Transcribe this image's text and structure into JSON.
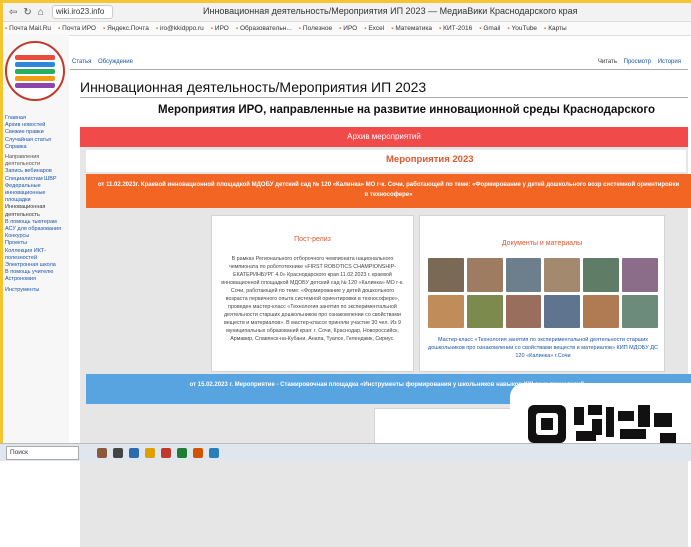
{
  "browser": {
    "url": "wiki.iro23.info",
    "title": "Инновационная деятельность/Мероприятия ИП 2023 — МедиаВики Краснодарского края"
  },
  "bookmarks": [
    "Почта Mail.Ru",
    "Почта ИРО",
    "Яндекс.Почта",
    "iro@kkidppo.ru",
    "ИРО",
    "Образовательн...",
    "Полезное",
    "ИРО",
    "Excel",
    "Математика",
    "КИТ-2016",
    "Gmail",
    "YouTube",
    "Карты"
  ],
  "sidebar": {
    "links": [
      "Главная",
      "Архив новостей",
      "Свежие правки",
      "Случайная статья",
      "Справка"
    ],
    "section_links": [
      "Направления деятельности",
      "Запись вебинаров",
      "Специалистам ШВР",
      "Федеральные инновационные площадки",
      "Инновационная деятельность",
      "В помощь тьютерам",
      "АСУ для образования",
      "Конкурсы",
      "Проекты",
      "Коллекция ИКТ-полезностей",
      "Электронная школа",
      "В помощь учителю Астрономия"
    ],
    "tools": "Инструменты"
  },
  "tabs": {
    "left": [
      "Статья",
      "Обсуждение"
    ],
    "right": [
      "Читать",
      "Просмотр",
      "История"
    ]
  },
  "page": {
    "title": "Инновационная деятельность/Мероприятия ИП 2023",
    "heading": "Мероприятия ИРО, направленные на развитие инновационной среды Краснодарского",
    "archive": "Архив мероприятий",
    "events_title": "Мероприятия 2023",
    "event1": "от 11.02.2023г. Краевой инновационной площадкой МДОБУ детский сад № 120 «Калинка» МО г-к. Сочи, работающей по теме: «Формирование у детей дошкольного возр системной ориентировки в технософере»",
    "press_title": "Пост-релиз",
    "press_text": "В рамках Регионального отборочного чемпионата национального чемпионата по робототехнике «FIRST ROBOTICS CHAMPIONSHIP-ЕКАТЕРИНБУРГ 4.0» Краснодарского края 11.02.2023 г. краевой инновационной площадкой МДОБУ детский сад № 120 «Калинка» МО г-к. Сочи, работающей по теме: «Формирование у детей дошкольного возраста первичного опыта системной ориентировки в технософере», проведен мастер-класс «Технология занятия по экспериментальной деятельности старших дошкольников про ознакомлении со свойствами веществ и материалов». В мастер-классе приняли участие 30 чел. Из 9 муниципальных образований края: г. Сочи, Краснодар, Новороссийск, Армавир, Славянск-на-Кубани, Анапа, Туапсе, Геленджик, Сириус.",
    "docs_title": "Документы и материалы",
    "docs_caption": "Мастер-класс «Технология занятия по экспериментальной деятельности старших дошкольников про ознакомлении со свойствами веществ и материалов» КИП МДОБУ ДС 120 «Калинка» г.Сочи",
    "event2": "от 15.02.2023 г. Мероприятие - Стажировочная площадка «Инструменты формирования у школьников навыков XXI века технологий»",
    "docs_title_2": "Докум"
  },
  "taskbar": {
    "search": "Поиск"
  },
  "colors": {
    "archive": "#f04a4a",
    "event_orange": "#f26522",
    "event_blue": "#57a4e0",
    "accent_text": "#e0562c",
    "link": "#1a55a8",
    "frame": "#f3c531"
  }
}
